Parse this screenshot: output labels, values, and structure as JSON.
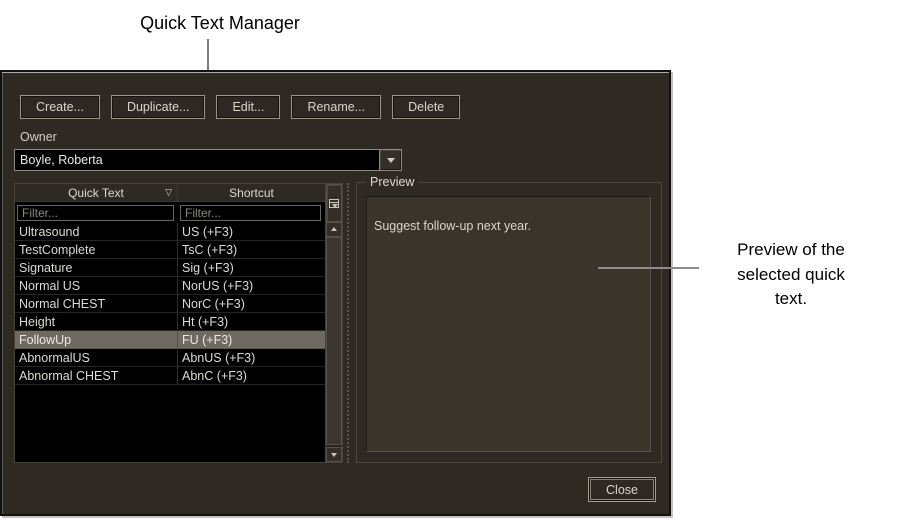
{
  "annotations": {
    "title": "Quick Text Manager",
    "preview_note_lines": [
      "Preview of the",
      "selected quick",
      "text."
    ]
  },
  "dialog": {
    "toolbar": {
      "buttons": [
        {
          "label": "Create..."
        },
        {
          "label": "Duplicate..."
        },
        {
          "label": "Edit..."
        },
        {
          "label": "Rename..."
        },
        {
          "label": "Delete"
        }
      ]
    },
    "owner": {
      "label": "Owner",
      "value": "Boyle, Roberta"
    },
    "table": {
      "columns": {
        "quick_text_header": "Quick Text",
        "shortcut_header": "Shortcut"
      },
      "sort_indicator": "▽",
      "filter_placeholder": "Filter...",
      "rows": [
        {
          "quick_text": "Ultrasound",
          "shortcut": "US (+F3)",
          "selected": false
        },
        {
          "quick_text": "TestComplete",
          "shortcut": "TsC (+F3)",
          "selected": false
        },
        {
          "quick_text": "Signature",
          "shortcut": "Sig (+F3)",
          "selected": false
        },
        {
          "quick_text": "Normal US",
          "shortcut": "NorUS (+F3)",
          "selected": false
        },
        {
          "quick_text": "Normal CHEST",
          "shortcut": "NorC (+F3)",
          "selected": false
        },
        {
          "quick_text": "Height",
          "shortcut": "Ht (+F3)",
          "selected": false
        },
        {
          "quick_text": "FollowUp",
          "shortcut": "FU (+F3)",
          "selected": true
        },
        {
          "quick_text": "AbnormalUS",
          "shortcut": "AbnUS (+F3)",
          "selected": false
        },
        {
          "quick_text": "Abnormal CHEST",
          "shortcut": "AbnC (+F3)",
          "selected": false
        }
      ]
    },
    "preview": {
      "label": "Preview",
      "text": "Suggest follow-up next year."
    },
    "close_button": {
      "label": "Close"
    }
  },
  "colors": {
    "dialog_bg": "#2e2923",
    "table_bg": "#000000",
    "preview_bg": "#3b342b",
    "selection_bg": "#6f6a61",
    "text_light": "#dcdad0"
  }
}
